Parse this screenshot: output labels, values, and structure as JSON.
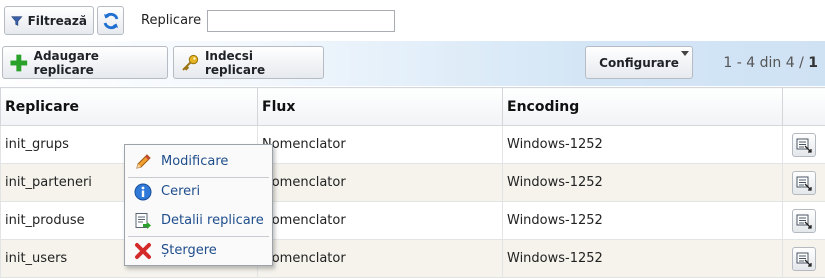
{
  "filter_bar": {
    "filter_button_label": "Filtrează",
    "search_label": "Replicare",
    "search_value": ""
  },
  "toolbar": {
    "add_label": "Adaugare replicare",
    "index_label": "Indecsi replicare",
    "config_label": "Configurare",
    "pager": {
      "range": "1 - 4 din 4 /",
      "page": "1"
    }
  },
  "table": {
    "headers": [
      "Replicare",
      "Flux",
      "Encoding",
      ""
    ],
    "rows": [
      {
        "replicare": "init_grups",
        "flux": "Nomenclator",
        "encoding": "Windows-1252"
      },
      {
        "replicare": "init_parteneri",
        "flux": "Nomenclator",
        "encoding": "Windows-1252"
      },
      {
        "replicare": "init_produse",
        "flux": "Nomenclator",
        "encoding": "Windows-1252"
      },
      {
        "replicare": "init_users",
        "flux": "Nomenclator",
        "encoding": "Windows-1252"
      }
    ]
  },
  "context_menu": {
    "items": [
      {
        "label": "Modificare",
        "icon": "pencil-icon"
      },
      {
        "label": "Cereri",
        "icon": "info-icon"
      },
      {
        "label": "Detalii replicare",
        "icon": "details-icon"
      },
      {
        "label": "Ștergere",
        "icon": "delete-icon"
      }
    ]
  },
  "colors": {
    "menu_text": "#1f4e8c",
    "row_alt": "#f5f3ec",
    "toolbar_gradient_end": "#cfe2f4"
  }
}
